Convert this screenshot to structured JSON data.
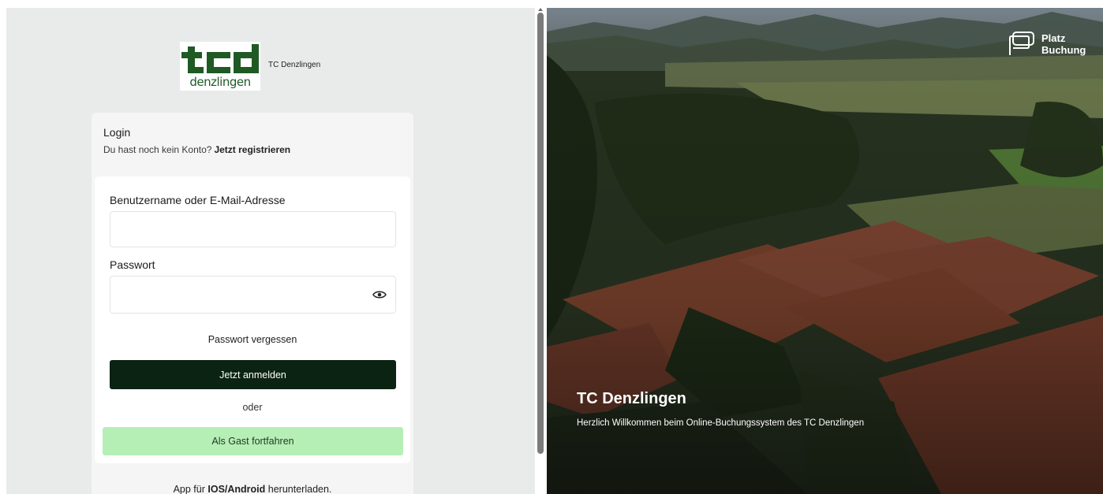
{
  "brand": {
    "name": "TC Denzlingen",
    "logo_text_top": "tcd",
    "logo_text_bottom": "denzlingen"
  },
  "login": {
    "title": "Login",
    "register_prompt": "Du hast noch kein Konto?",
    "register_link": "Jetzt registrieren",
    "username_label": "Benutzername oder E-Mail-Adresse",
    "username_value": "",
    "password_label": "Passwort",
    "password_value": "",
    "forgot_password": "Passwort vergessen",
    "submit_label": "Jetzt anmelden",
    "or_text": "oder",
    "guest_label": "Als Gast fortfahren"
  },
  "app_download": {
    "prefix": "App für",
    "platforms": "IOS/Android",
    "suffix": "herunterladen."
  },
  "hero": {
    "product_line1": "Platz",
    "product_line2": "Buchung",
    "title": "TC Denzlingen",
    "subtitle": "Herzlich Willkommen beim Online-Buchungssystem des TC Denzlingen"
  },
  "colors": {
    "primary_button": "#0b2312",
    "guest_button": "#b6efb6",
    "left_background": "#e9ebea",
    "logo_green": "#1f5a25"
  },
  "icons": {
    "password_toggle": "eye-icon",
    "product_logo": "platz-buchung-logo-icon"
  }
}
